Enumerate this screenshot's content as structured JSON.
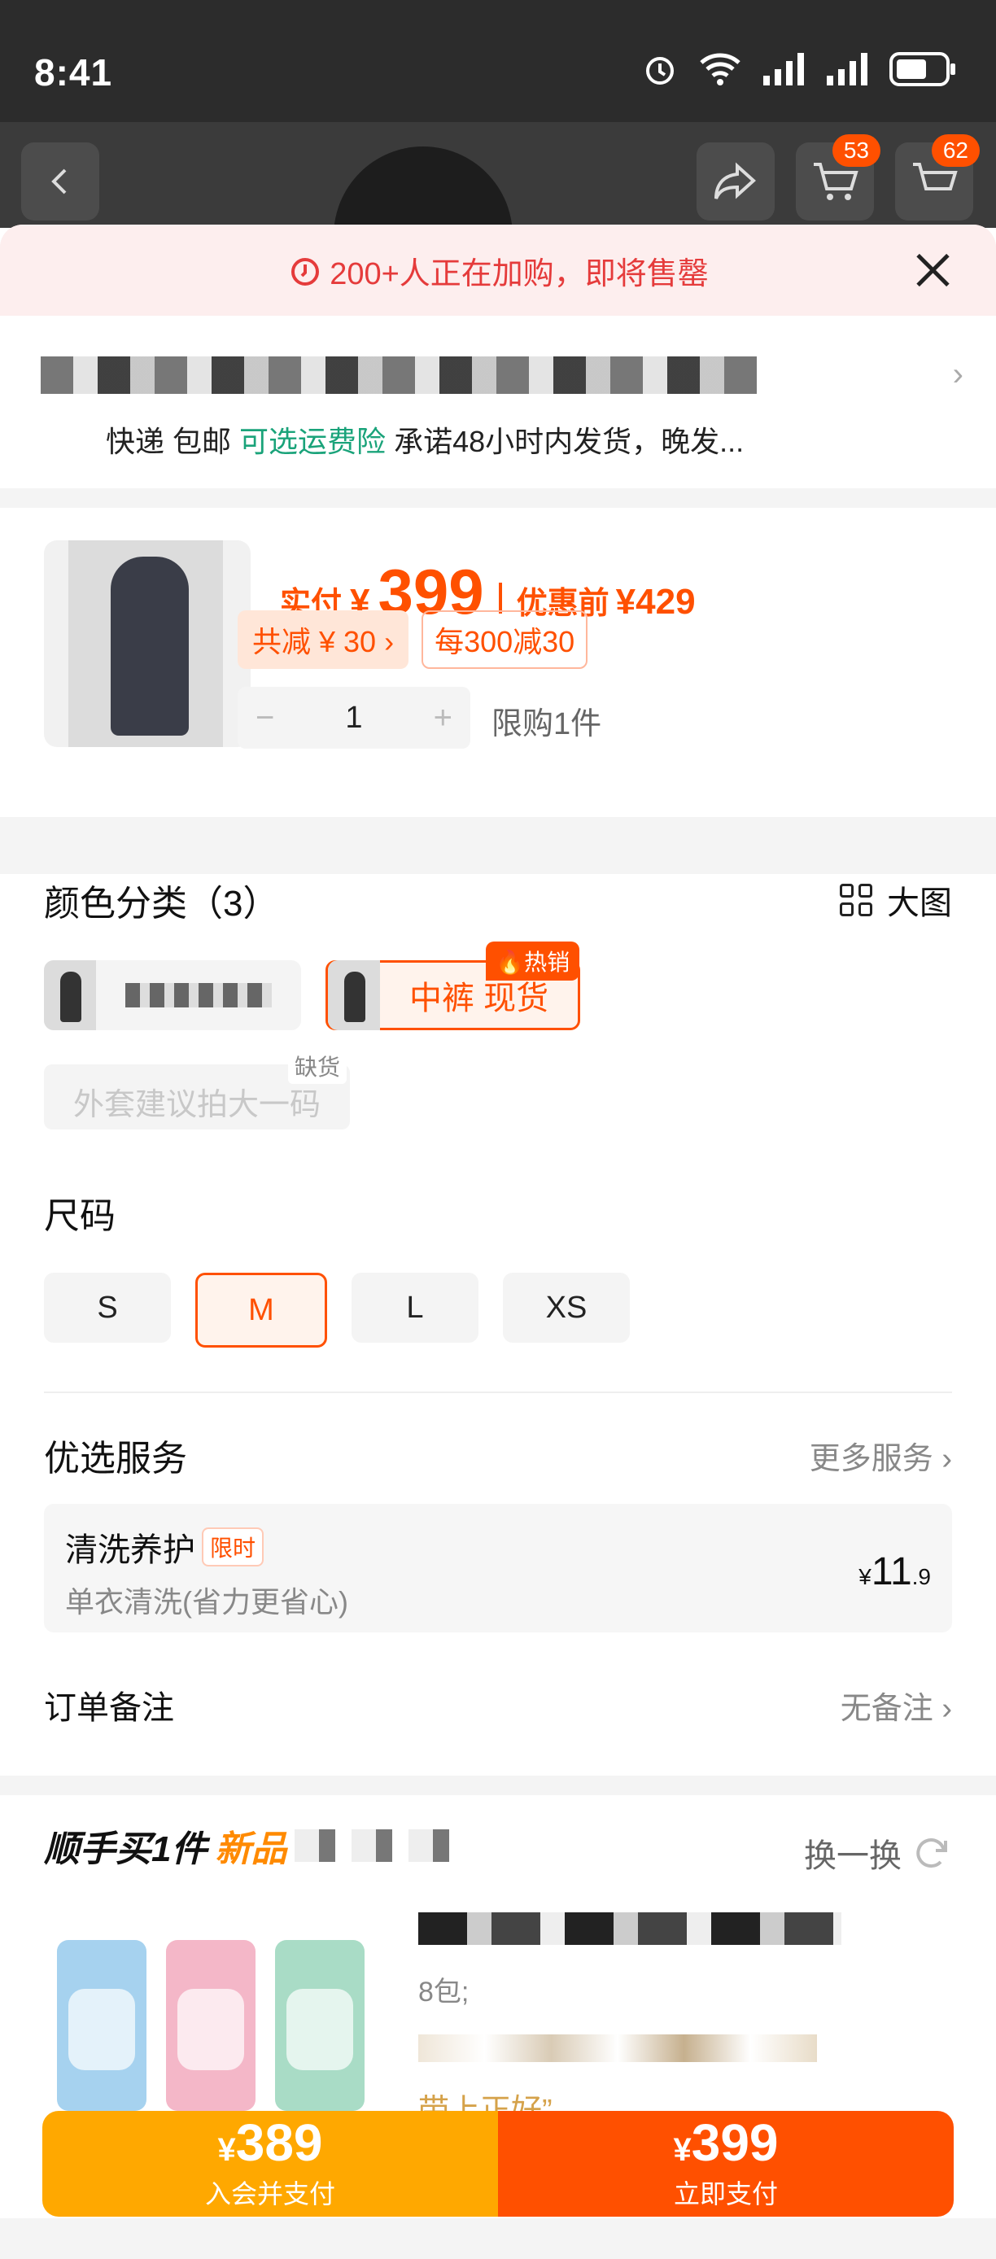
{
  "status_bar": {
    "time": "8:41"
  },
  "header": {
    "cart_count_1": "53",
    "cart_count_2": "62"
  },
  "alert": {
    "text": "200+人正在加购，即将售罄"
  },
  "delivery": {
    "express": "快递 包邮",
    "insurance": "可选运费险",
    "promise": "承诺48小时内发货，晚发..."
  },
  "product": {
    "paid_label": "实付",
    "currency": "¥",
    "price": "399",
    "before_label": "优惠前",
    "before_price": "¥429",
    "discount_tag": "共减 ¥ 30 ›",
    "promo_tag": "每300减30",
    "quantity": "1",
    "limit": "限购1件"
  },
  "color": {
    "title": "颜色分类（3）",
    "big_image_label": "大图",
    "options": [
      {
        "label": ""
      },
      {
        "label": "中裤 现货",
        "badge": "热销"
      },
      {
        "label": "外套建议拍大一码",
        "badge": "缺货"
      }
    ]
  },
  "size": {
    "title": "尺码",
    "options": [
      "S",
      "M",
      "L",
      "XS"
    ],
    "selected": "M"
  },
  "services": {
    "title": "优选服务",
    "more": "更多服务",
    "item": {
      "name": "清洗养护",
      "tag": "限时",
      "desc": "单衣清洗(省力更省心)",
      "price_currency": "¥",
      "price_int": "11",
      "price_dec": ".9"
    }
  },
  "order_note": {
    "label": "订单备注",
    "value": "无备注"
  },
  "recommend": {
    "title": "顺手买1件",
    "new_label": "新品",
    "swap_label": "换一换",
    "line1": "8包;",
    "line2": "带上正好”"
  },
  "pay": {
    "member": {
      "currency": "¥",
      "amount": "389",
      "label": "入会并支付"
    },
    "now": {
      "currency": "¥",
      "amount": "399",
      "label": "立即支付"
    }
  },
  "colors": {
    "accent": "#ff5000",
    "member": "#ffa800",
    "green": "#1aa37a",
    "alert_bg": "#fdeeee"
  }
}
